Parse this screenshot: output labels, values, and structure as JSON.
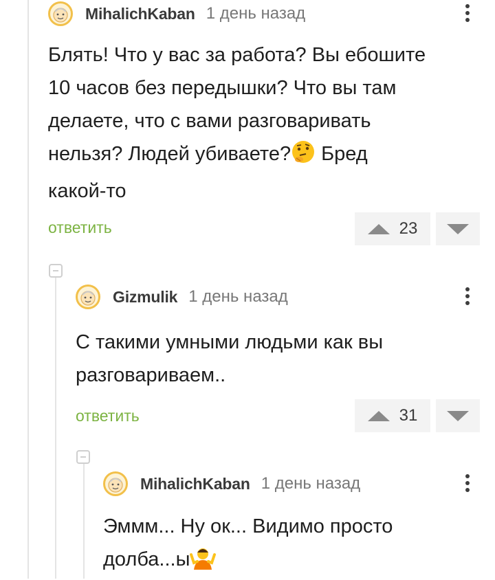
{
  "comments": [
    {
      "author": "MihalichKaban",
      "time": "1 день назад",
      "lines": [
        "Блять! Что у вас за работа? Вы ебошите",
        "10 часов без передышки? Что вы там",
        "делаете, что с вами разговаривать"
      ],
      "line4": "нельзя? Людей убиваете?",
      "line4_after": " Бред",
      "line5": "какой-то",
      "emoji": "thinking-face-icon",
      "reply": "ответить",
      "votes": "23"
    },
    {
      "author": "Gizmulik",
      "time": "1 день назад",
      "lines": [
        "С такими умными людьми как вы",
        "разговариваем.."
      ],
      "reply": "ответить",
      "votes": "31"
    },
    {
      "author": "MihalichKaban",
      "time": "1 день назад",
      "lines": [
        "Эммм... Ну ок... Видимо просто"
      ],
      "line2": "долба...ы",
      "emoji": "person-shrugging-icon"
    }
  ],
  "colors": {
    "reply": "#7cb342",
    "avatar_border": "#f2c04a",
    "vote_bg": "#f3f3f3"
  }
}
